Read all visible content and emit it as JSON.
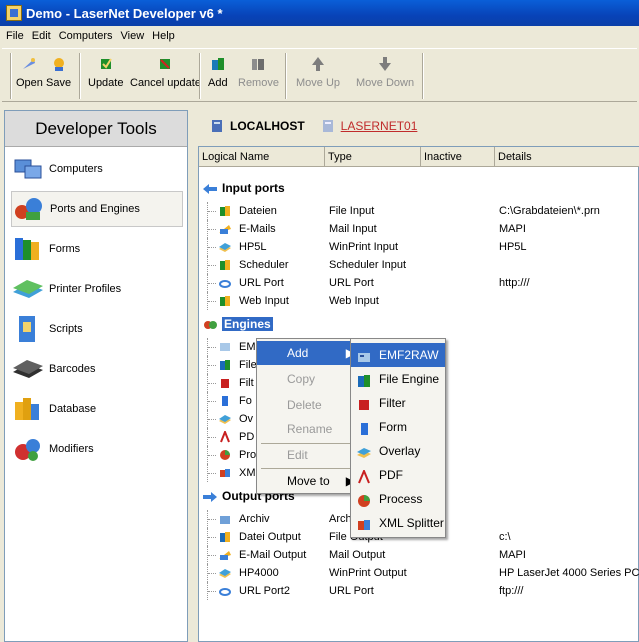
{
  "window": {
    "title": "Demo - LaserNet Developer v6  *"
  },
  "menubar": [
    "File",
    "Edit",
    "Computers",
    "View",
    "Help"
  ],
  "toolbar": {
    "open": "Open",
    "save": "Save",
    "update": "Update",
    "cancel_update": "Cancel update",
    "add": "Add",
    "remove": "Remove",
    "move_up": "Move Up",
    "move_down": "Move Down"
  },
  "sidebar": {
    "title": "Developer Tools",
    "items": [
      {
        "label": "Computers",
        "icon": "computers-icon"
      },
      {
        "label": "Ports and Engines",
        "icon": "ports-engines-icon"
      },
      {
        "label": "Forms",
        "icon": "forms-icon"
      },
      {
        "label": "Printer Profiles",
        "icon": "printer-profiles-icon"
      },
      {
        "label": "Scripts",
        "icon": "scripts-icon"
      },
      {
        "label": "Barcodes",
        "icon": "barcodes-icon"
      },
      {
        "label": "Database",
        "icon": "database-icon"
      },
      {
        "label": "Modifiers",
        "icon": "modifiers-icon"
      }
    ]
  },
  "hosts": {
    "primary": "LOCALHOST",
    "secondary": "LASERNET01"
  },
  "grid": {
    "columns": [
      "Logical Name",
      "Type",
      "Inactive",
      "Details"
    ],
    "input_ports": {
      "label": "Input ports",
      "rows": [
        {
          "name": "Dateien",
          "type": "File Input",
          "details": "C:\\Grabdateien\\*.prn"
        },
        {
          "name": "E-Mails",
          "type": "Mail Input",
          "details": "MAPI"
        },
        {
          "name": "HP5L",
          "type": "WinPrint Input",
          "details": "HP5L"
        },
        {
          "name": "Scheduler",
          "type": "Scheduler Input",
          "details": ""
        },
        {
          "name": "URL Port",
          "type": "URL Port",
          "details": "http:///"
        },
        {
          "name": "Web Input",
          "type": "Web Input",
          "details": ""
        }
      ]
    },
    "engines": {
      "label": "Engines",
      "rows": [
        {
          "name": "EM",
          "type": ""
        },
        {
          "name": "File",
          "type": ""
        },
        {
          "name": "Filt",
          "type": ""
        },
        {
          "name": "Fo",
          "type": ""
        },
        {
          "name": "Ov",
          "type": ""
        },
        {
          "name": "PD",
          "type": ""
        },
        {
          "name": "Pro",
          "type": ""
        },
        {
          "name": "XML Splitter",
          "type": "XML"
        }
      ]
    },
    "output_ports": {
      "label": "Output ports",
      "rows": [
        {
          "name": "Archiv",
          "type": "Archive",
          "details": ""
        },
        {
          "name": "Datei Output",
          "type": "File Output",
          "details": "c:\\"
        },
        {
          "name": "E-Mail Output",
          "type": "Mail Output",
          "details": "MAPI"
        },
        {
          "name": "HP4000",
          "type": "WinPrint Output",
          "details": "HP LaserJet 4000 Series PCL"
        },
        {
          "name": "URL Port2",
          "type": "URL Port",
          "details": "ftp:///"
        }
      ]
    }
  },
  "context_menu": {
    "items": [
      {
        "label": "Add",
        "enabled": true,
        "submenu": true
      },
      {
        "label": "Copy",
        "enabled": false
      },
      {
        "label": "Delete",
        "enabled": false
      },
      {
        "label": "Rename",
        "enabled": false
      },
      {
        "label": "Edit",
        "enabled": false
      },
      {
        "label": "Move to",
        "enabled": true,
        "submenu": true
      }
    ]
  },
  "add_submenu": {
    "items": [
      "EMF2RAW",
      "File Engine",
      "Filter",
      "Form",
      "Overlay",
      "PDF",
      "Process",
      "XML Splitter"
    ]
  },
  "colors": {
    "selection": "#316ac5",
    "title_bar": "#0a5fd8",
    "link_red": "#c02b2b"
  }
}
